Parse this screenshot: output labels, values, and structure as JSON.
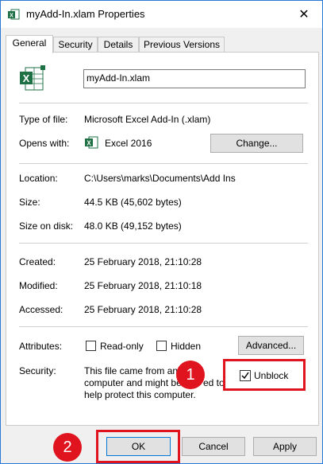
{
  "window": {
    "title": "myAdd-In.xlam Properties",
    "close_glyph": "✕"
  },
  "tabs": [
    {
      "label": "General"
    },
    {
      "label": "Security"
    },
    {
      "label": "Details"
    },
    {
      "label": "Previous Versions"
    }
  ],
  "general": {
    "filename": "myAdd-In.xlam",
    "type_label": "Type of file:",
    "type_value": "Microsoft Excel Add-In (.xlam)",
    "opens_label": "Opens with:",
    "opens_value": "Excel 2016",
    "change_button": "Change...",
    "location_label": "Location:",
    "location_value": "C:\\Users\\marks\\Documents\\Add Ins",
    "size_label": "Size:",
    "size_value": "44.5 KB (45,602 bytes)",
    "size_disk_label": "Size on disk:",
    "size_disk_value": "48.0 KB (49,152 bytes)",
    "created_label": "Created:",
    "created_value": "25 February 2018, 21:10:28",
    "modified_label": "Modified:",
    "modified_value": "25 February 2018, 21:10:18",
    "accessed_label": "Accessed:",
    "accessed_value": "25 February 2018, 21:10:28",
    "attributes_label": "Attributes:",
    "readonly_label": "Read-only",
    "hidden_label": "Hidden",
    "advanced_button": "Advanced...",
    "security_label": "Security:",
    "security_line1": "This file came from an",
    "security_line2": "computer and might be",
    "security_line2_tail": "ed to",
    "security_line3": "help protect this computer.",
    "unblock_label": "Unblock"
  },
  "buttons": {
    "ok": "OK",
    "cancel": "Cancel",
    "apply": "Apply"
  },
  "annotations": {
    "badge1": "1",
    "badge2": "2"
  },
  "colors": {
    "accent": "#e0141e",
    "excel_green": "#1e7145",
    "window_border": "#2b79d4"
  }
}
